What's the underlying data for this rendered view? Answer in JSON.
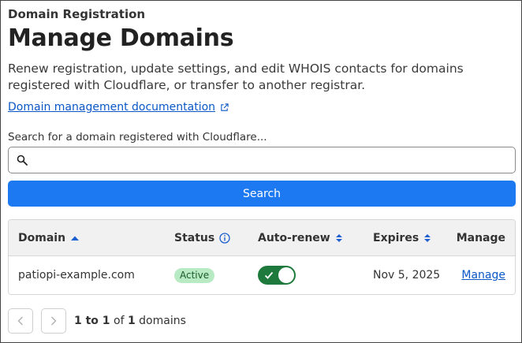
{
  "header": {
    "eyebrow": "Domain Registration",
    "title": "Manage Domains",
    "description": "Renew registration, update settings, and edit WHOIS contacts for domains registered with Cloudflare, or transfer to another registrar.",
    "doc_link": "Domain management documentation"
  },
  "search": {
    "label": "Search for a domain registered with Cloudflare...",
    "value": "",
    "placeholder": "",
    "button_label": "Search"
  },
  "table": {
    "columns": {
      "domain": "Domain",
      "status": "Status",
      "auto_renew": "Auto-renew",
      "expires": "Expires",
      "manage": "Manage"
    },
    "rows": [
      {
        "domain": "patiopi-example.com",
        "status": "Active",
        "auto_renew": true,
        "expires": "Nov 5, 2025",
        "manage": "Manage"
      }
    ]
  },
  "pagination": {
    "range": "1 to 1",
    "of": "of",
    "total": "1",
    "unit": "domains"
  },
  "colors": {
    "accent": "#1d79f2",
    "link": "#0b57c7",
    "toggle_on": "#1e7a3c",
    "badge_bg": "#b8ebc4"
  },
  "icons": {
    "search": "search-icon",
    "external": "external-link-icon",
    "info": "info-icon",
    "sort_up": "sort-ascending-icon",
    "sort_both": "sort-icon",
    "prev": "chevron-left-icon",
    "next": "chevron-right-icon",
    "check": "check-icon"
  }
}
